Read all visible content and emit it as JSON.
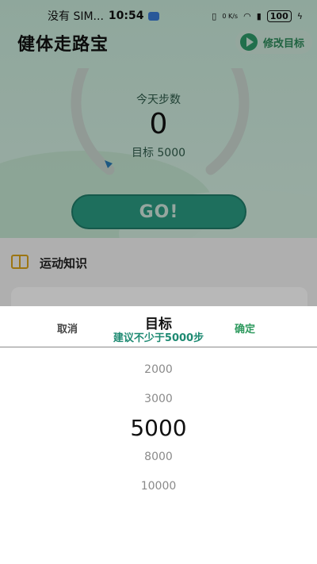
{
  "status_bar": {
    "carrier": "没有 SIM...",
    "time": "10:54",
    "net_speed": "0 K/s",
    "battery": "100"
  },
  "header": {
    "title": "健体走路宝",
    "edit_goal_label": "修改目标"
  },
  "dashboard": {
    "today_label": "今天步数",
    "steps": "0",
    "goal_text": "目标 5000",
    "go_label": "GO!"
  },
  "knowledge": {
    "title": "运动知识"
  },
  "picker_sheet": {
    "cancel_label": "取消",
    "confirm_label": "确定",
    "title": "目标",
    "subtitle": "建议不少于5000步",
    "options": [
      "2000",
      "3000",
      "5000",
      "8000",
      "10000"
    ],
    "selected": "5000"
  },
  "colors": {
    "accent_green": "#2e9a5e",
    "go_button": "#2a9a82",
    "subtitle_teal": "#1e8a72"
  }
}
